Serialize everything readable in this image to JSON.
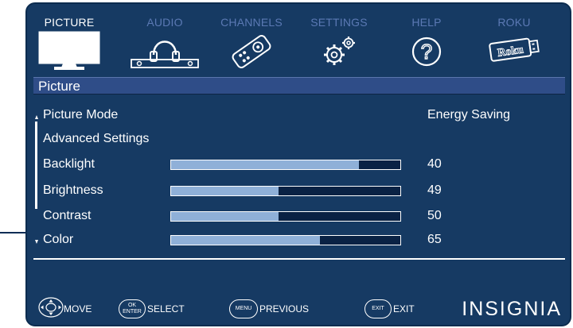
{
  "tabs": [
    {
      "label": "PICTURE",
      "icon": "tv-icon",
      "active": true
    },
    {
      "label": "AUDIO",
      "icon": "headphones-icon",
      "active": false
    },
    {
      "label": "CHANNELS",
      "icon": "remote-icon",
      "active": false
    },
    {
      "label": "SETTINGS",
      "icon": "gears-icon",
      "active": false
    },
    {
      "label": "HELP",
      "icon": "help-icon",
      "active": false
    },
    {
      "label": "ROKU",
      "icon": "roku-stick-icon",
      "active": false,
      "icon_text": "Roku"
    }
  ],
  "section_title": "Picture",
  "rows": {
    "picture_mode": {
      "label": "Picture Mode",
      "value": "Energy Saving"
    },
    "advanced": {
      "label": "Advanced Settings"
    },
    "backlight": {
      "label": "Backlight",
      "value": "40",
      "level": 0.82
    },
    "brightness": {
      "label": "Brightness",
      "value": "49",
      "level": 0.47
    },
    "contrast": {
      "label": "Contrast",
      "value": "50",
      "level": 0.47
    },
    "color": {
      "label": "Color",
      "value": "65",
      "level": 0.65
    }
  },
  "footer": {
    "move": {
      "label": "MOVE",
      "icon": "dpad-icon"
    },
    "select": {
      "label": "SELECT",
      "button_top": "OK",
      "button_bottom": "ENTER"
    },
    "previous": {
      "label": "PREVIOUS",
      "button": "MENU"
    },
    "exit": {
      "label": "EXIT",
      "button": "EXIT"
    },
    "brand": "INSIGNIA"
  },
  "colors": {
    "background": "#163a63",
    "title_bar": "#2f4d88",
    "inactive_tab": "#5b79b4",
    "slider_fill": "#8fb0d8",
    "text": "#ffffff"
  }
}
